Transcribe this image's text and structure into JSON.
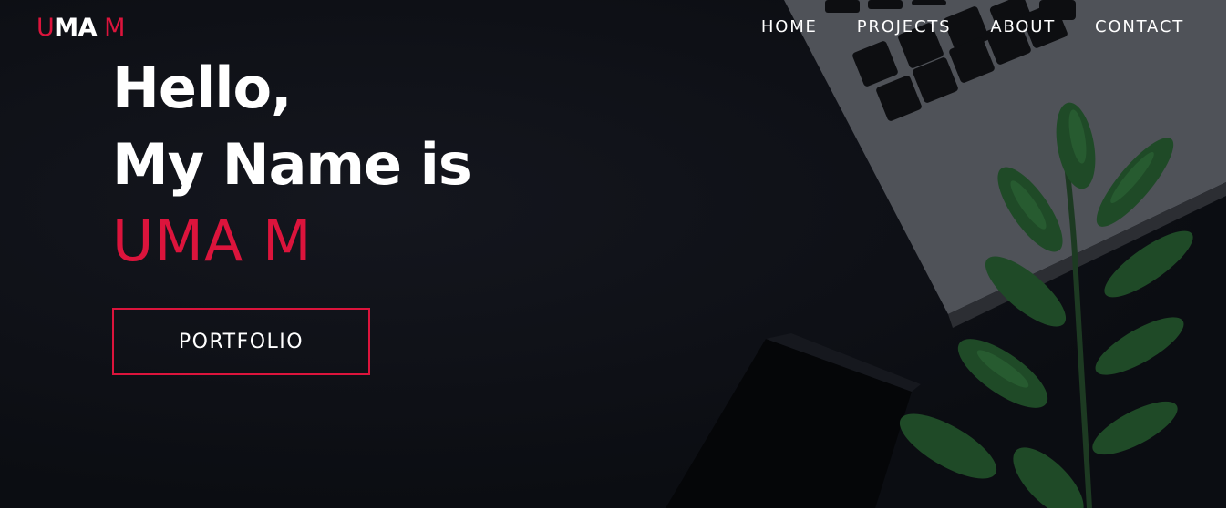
{
  "logo": {
    "part1": "U",
    "part2": "MA",
    "part3": " M"
  },
  "nav": {
    "items": [
      {
        "label": "HOME"
      },
      {
        "label": "PROJECTS"
      },
      {
        "label": "ABOUT"
      },
      {
        "label": "CONTACT"
      }
    ]
  },
  "hero": {
    "line1": "Hello,",
    "line2": "My Name is",
    "name": "UMA M",
    "button_label": "PORTFOLIO"
  },
  "colors": {
    "accent": "#dc143c",
    "background": "#0b0d12",
    "text": "#ffffff"
  },
  "icons": [
    "laptop-keyboard-image",
    "plant-leaves-image",
    "phone-image"
  ]
}
